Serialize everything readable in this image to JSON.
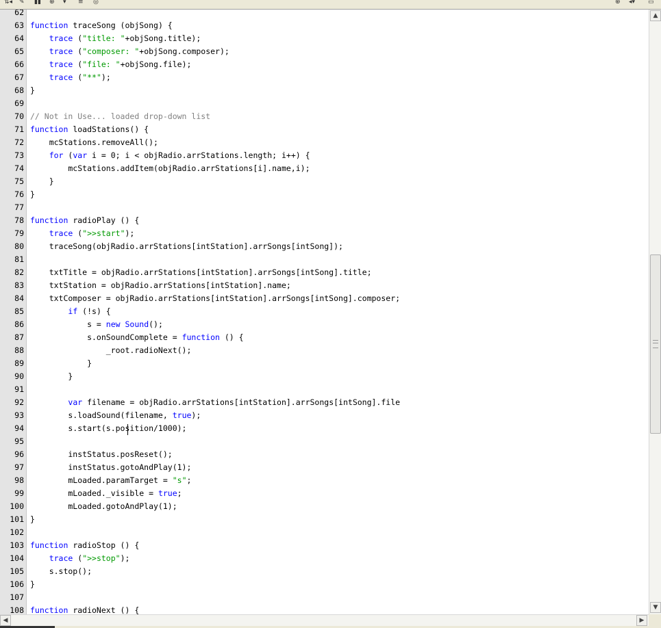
{
  "toolbar": {
    "icons": [
      "arrows-icon",
      "wrench-icon",
      "bars-icon",
      "target-icon",
      "dropdown-icon",
      "list-icon",
      "help-icon",
      "window-icon"
    ]
  },
  "editor": {
    "lines": [
      {
        "n": "62",
        "code": ""
      },
      {
        "n": "63",
        "code": "function traceSong (objSong) {"
      },
      {
        "n": "64",
        "code": "    trace (\"title: \"+objSong.title);"
      },
      {
        "n": "65",
        "code": "    trace (\"composer: \"+objSong.composer);"
      },
      {
        "n": "66",
        "code": "    trace (\"file: \"+objSong.file);"
      },
      {
        "n": "67",
        "code": "    trace (\"**\");"
      },
      {
        "n": "68",
        "code": "}"
      },
      {
        "n": "69",
        "code": ""
      },
      {
        "n": "70",
        "code": "// Not in Use... loaded drop-down list"
      },
      {
        "n": "71",
        "code": "function loadStations() {"
      },
      {
        "n": "72",
        "code": "    mcStations.removeAll();"
      },
      {
        "n": "73",
        "code": "    for (var i = 0; i < objRadio.arrStations.length; i++) {"
      },
      {
        "n": "74",
        "code": "        mcStations.addItem(objRadio.arrStations[i].name,i);"
      },
      {
        "n": "75",
        "code": "    }"
      },
      {
        "n": "76",
        "code": "}"
      },
      {
        "n": "77",
        "code": ""
      },
      {
        "n": "78",
        "code": "function radioPlay () {"
      },
      {
        "n": "79",
        "code": "    trace (\">>start\");"
      },
      {
        "n": "80",
        "code": "    traceSong(objRadio.arrStations[intStation].arrSongs[intSong]);"
      },
      {
        "n": "81",
        "code": ""
      },
      {
        "n": "82",
        "code": "    txtTitle = objRadio.arrStations[intStation].arrSongs[intSong].title;"
      },
      {
        "n": "83",
        "code": "    txtStation = objRadio.arrStations[intStation].name;"
      },
      {
        "n": "84",
        "code": "    txtComposer = objRadio.arrStations[intStation].arrSongs[intSong].composer;"
      },
      {
        "n": "85",
        "code": "        if (!s) {"
      },
      {
        "n": "86",
        "code": "            s = new Sound();"
      },
      {
        "n": "87",
        "code": "            s.onSoundComplete = function () {"
      },
      {
        "n": "88",
        "code": "                _root.radioNext();"
      },
      {
        "n": "89",
        "code": "            }"
      },
      {
        "n": "90",
        "code": "        }"
      },
      {
        "n": "91",
        "code": ""
      },
      {
        "n": "92",
        "code": "        var filename = objRadio.arrStations[intStation].arrSongs[intSong].file"
      },
      {
        "n": "93",
        "code": "        s.loadSound(filename, true);"
      },
      {
        "n": "94",
        "code": "        s.start(s.position/1000);"
      },
      {
        "n": "95",
        "code": ""
      },
      {
        "n": "96",
        "code": "        instStatus.posReset();"
      },
      {
        "n": "97",
        "code": "        instStatus.gotoAndPlay(1);"
      },
      {
        "n": "98",
        "code": "        mLoaded.paramTarget = \"s\";"
      },
      {
        "n": "99",
        "code": "        mLoaded._visible = true;"
      },
      {
        "n": "100",
        "code": "        mLoaded.gotoAndPlay(1);"
      },
      {
        "n": "101",
        "code": "}"
      },
      {
        "n": "102",
        "code": ""
      },
      {
        "n": "103",
        "code": "function radioStop () {"
      },
      {
        "n": "104",
        "code": "    trace (\">>stop\");"
      },
      {
        "n": "105",
        "code": "    s.stop();"
      },
      {
        "n": "106",
        "code": "}"
      },
      {
        "n": "107",
        "code": ""
      },
      {
        "n": "108",
        "code": "function radioNext () {"
      }
    ]
  },
  "scrollbar": {
    "up_arrow": "▲",
    "down_arrow": "▼",
    "left_arrow": "◀",
    "right_arrow": "▶",
    "vertical_position": 0.5
  },
  "colors": {
    "keyword": "#0000ff",
    "string": "#009900",
    "comment": "#808080",
    "gutter": "#e4e4e4"
  }
}
